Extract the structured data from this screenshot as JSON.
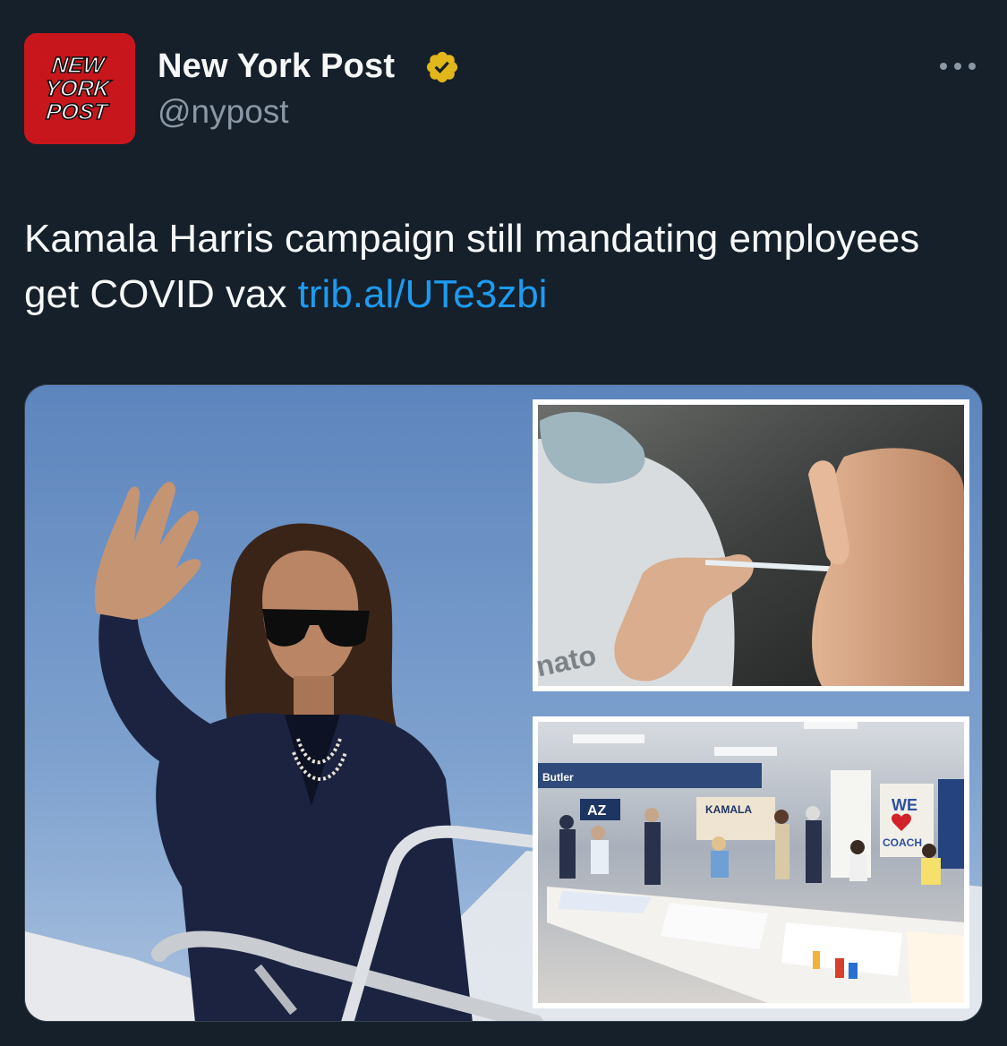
{
  "author": {
    "display_name": "New York Post",
    "handle": "@nypost",
    "avatar_logo_text": [
      "NEW",
      "YORK",
      "POST"
    ],
    "verified": true,
    "verified_badge_color": "#e2b719"
  },
  "tweet": {
    "text_before_link": "Kamala Harris campaign still mandating employees get COVID vax ",
    "link_text": "trib.al/UTe3zbi"
  },
  "media": {
    "signs_text": [
      "KAMALA",
      "WE",
      "COACH",
      "AZ",
      "Butler",
      "nato"
    ]
  },
  "colors": {
    "background": "#15202b",
    "text_primary": "#f7f9f9",
    "text_secondary": "#8b98a5",
    "link": "#1d9bf0",
    "avatar_red": "#c8161d"
  },
  "icons": {
    "verified": "verified-badge-icon",
    "more": "more-horizontal-icon"
  }
}
